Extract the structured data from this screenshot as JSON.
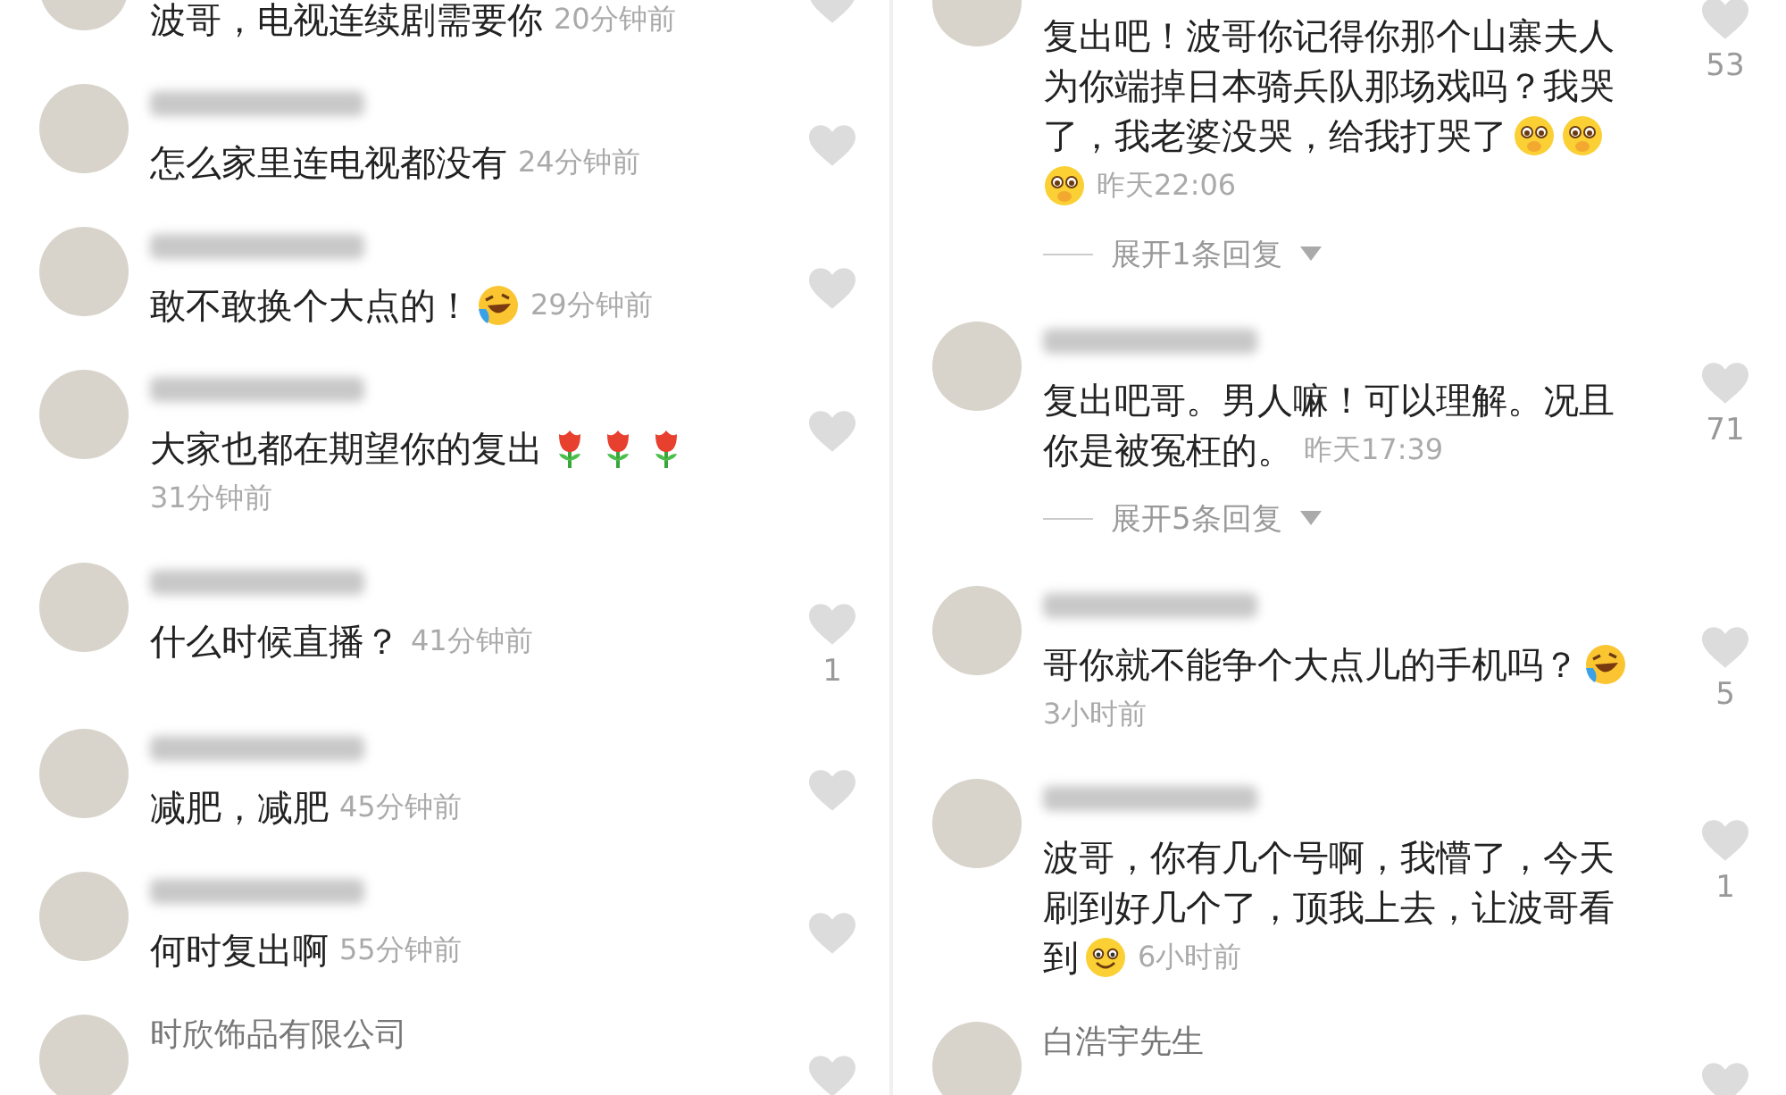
{
  "columns": [
    {
      "comments": [
        {
          "lines": [
            [
              {
                "kind": "text",
                "text": "波哥，电视连续剧需要你"
              },
              {
                "kind": "time",
                "text": "20分钟前"
              }
            ]
          ]
        },
        {
          "lines": [
            [
              {
                "kind": "text",
                "text": "怎么家里连电视都没有"
              },
              {
                "kind": "time",
                "text": "24分钟前"
              }
            ]
          ]
        },
        {
          "lines": [
            [
              {
                "kind": "text",
                "text": "敢不敢换个大点的！"
              },
              {
                "kind": "laugh-cry"
              },
              {
                "kind": "time",
                "text": "29分钟前"
              }
            ]
          ]
        },
        {
          "lines": [
            [
              {
                "kind": "text",
                "text": "大家也都在期望你的复出"
              },
              {
                "kind": "rose"
              },
              {
                "kind": "rose"
              },
              {
                "kind": "rose"
              }
            ],
            [
              {
                "kind": "time",
                "text": "31分钟前"
              }
            ]
          ]
        },
        {
          "lines": [
            [
              {
                "kind": "text",
                "text": "什么时候直播？"
              },
              {
                "kind": "time",
                "text": "41分钟前"
              }
            ]
          ],
          "likes": "1"
        },
        {
          "lines": [
            [
              {
                "kind": "text",
                "text": "减肥，减肥"
              },
              {
                "kind": "time",
                "text": "45分钟前"
              }
            ]
          ]
        },
        {
          "lines": [
            [
              {
                "kind": "text",
                "text": "何时复出啊"
              },
              {
                "kind": "time",
                "text": "55分钟前"
              }
            ]
          ]
        },
        {
          "name": "时欣饰品有限公司"
        }
      ]
    },
    {
      "comments": [
        {
          "lines": [
            [
              {
                "kind": "text",
                "text": "复出吧！波哥你记得你那个山寨夫人"
              }
            ],
            [
              {
                "kind": "text",
                "text": "为你端掉日本骑兵队那场戏吗？我哭"
              }
            ],
            [
              {
                "kind": "text",
                "text": "了，我老婆没哭，给我打哭了"
              },
              {
                "kind": "pleading"
              },
              {
                "kind": "pleading"
              }
            ],
            [
              {
                "kind": "pleading"
              },
              {
                "kind": "time",
                "text": "昨天22:06"
              }
            ]
          ],
          "likes": "53",
          "replies": "展开1条回复"
        },
        {
          "lines": [
            [
              {
                "kind": "text",
                "text": "复出吧哥。男人嘛！可以理解。况且"
              }
            ],
            [
              {
                "kind": "text",
                "text": "你是被冤枉的。"
              },
              {
                "kind": "time",
                "text": "昨天17:39"
              }
            ]
          ],
          "likes": "71",
          "replies": "展开5条回复"
        },
        {
          "lines": [
            [
              {
                "kind": "text",
                "text": "哥你就不能争个大点儿的手机吗？"
              },
              {
                "kind": "laugh-cry"
              }
            ],
            [
              {
                "kind": "time",
                "text": "3小时前"
              }
            ]
          ],
          "likes": "5"
        },
        {
          "lines": [
            [
              {
                "kind": "text",
                "text": "波哥，你有几个号啊，我懵了，今天"
              }
            ],
            [
              {
                "kind": "text",
                "text": "刷到好几个了，顶我上去，让波哥看"
              }
            ],
            [
              {
                "kind": "text",
                "text": "到"
              },
              {
                "kind": "smile"
              },
              {
                "kind": "time",
                "text": "6小时前"
              }
            ]
          ],
          "likes": "1"
        },
        {
          "name": "白浩宇先生"
        }
      ]
    }
  ]
}
